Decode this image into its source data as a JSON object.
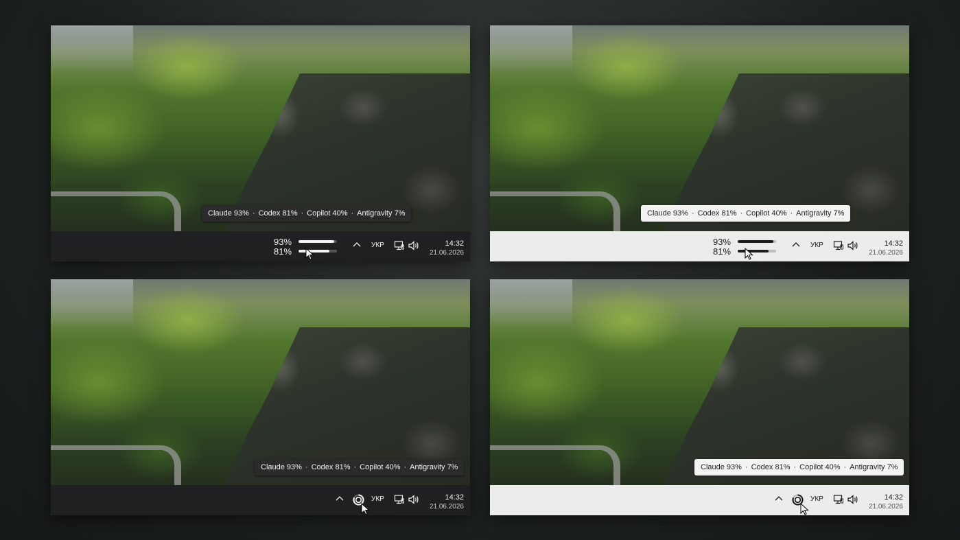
{
  "tooltip": {
    "items": [
      "Claude 93%",
      "Codex 81%",
      "Copilot 40%",
      "Antigravity 7%"
    ],
    "separator": "·"
  },
  "bars": [
    {
      "label": "93%",
      "value": 0.93
    },
    {
      "label": "81%",
      "value": 0.81
    }
  ],
  "tray": {
    "language": "УКР",
    "time": "14:32",
    "date": "21.06.2026"
  },
  "icons": [
    "chevron-up-icon",
    "network-icon",
    "volume-icon",
    "usage-ring-icon",
    "mouse-cursor-icon"
  ],
  "colors": {
    "dark_taskbar": "#1f2021",
    "light_taskbar": "#ececec",
    "dark_tooltip": "#2b2b2b",
    "light_tooltip": "#f3f3f3"
  }
}
